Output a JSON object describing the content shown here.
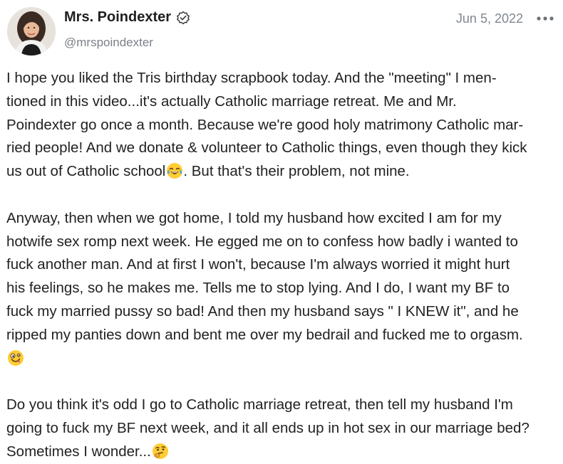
{
  "post": {
    "author": {
      "display_name": "Mrs. Poindexter",
      "handle": "@mrspoindexter",
      "verified_icon": "verified-badge-icon",
      "avatar_icon": "avatar-photo"
    },
    "date": "Jun 5, 2022",
    "more_icon": "more-horizontal-icon",
    "paragraphs": [
      {
        "text": "I hope you liked the Tris birthday scrapbook today. And the \"meeting\" I men-\ntioned in this video...it's actually Catholic marriage retreat. Me and Mr.\nPoindexter go once a month. Because we're good holy matrimony Catholic mar-\nried people! And we donate & volunteer to Catholic things, even though they kick\nus out of Catholic school",
        "after_emoji": ". But that's their problem, not mine.",
        "emoji": "tears-of-joy-emoji"
      },
      {
        "text": "Anyway, then when we got home, I told my husband how excited I am for my\nhotwife sex romp next week. He egged me on to confess how badly i wanted to\nfuck another man. And at first I won't, because I'm always worried it might hurt\nhis feelings, so he makes me. Tells me to stop lying. And I do, I want my BF to\nfuck my married pussy so bad! And then my husband says \" I KNEW it\", and he\nripped my panties down and bent me over my bedrail and fucked me to orgasm.\n",
        "after_emoji": "",
        "emoji": "zany-face-emoji"
      },
      {
        "text": "Do you think it's odd I go to Catholic marriage retreat, then tell my husband I'm\ngoing to fuck my BF next week, and it all ends up in hot sex in our marriage bed?\nSometimes I wonder...",
        "after_emoji": "",
        "emoji": "thinking-face-emoji"
      }
    ]
  },
  "colors": {
    "text": "#222222",
    "muted": "#7b8088",
    "emoji_yellow": "#ffcc33",
    "tear_blue": "#4aa8e0"
  }
}
